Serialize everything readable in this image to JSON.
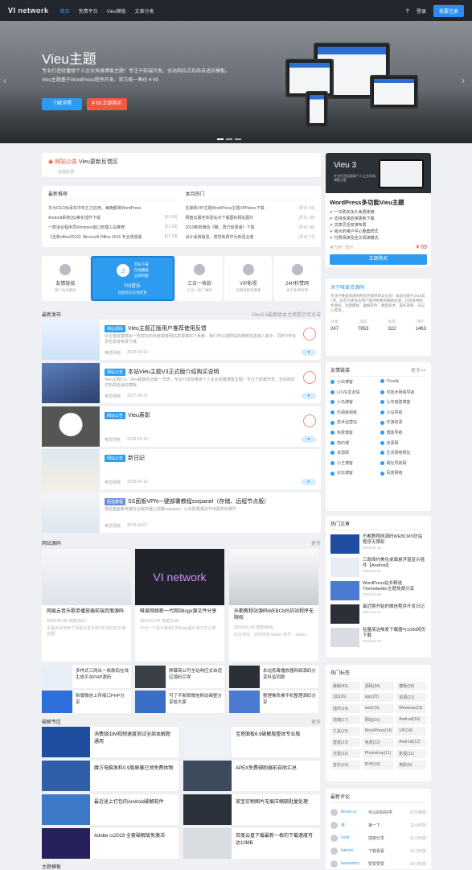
{
  "nav": {
    "logo": "VI",
    "logo2": "network",
    "items": [
      "首页",
      "免费平台",
      "Vieu模板",
      "文章分类"
    ],
    "login": "登录",
    "register": "我要注册"
  },
  "hero": {
    "title": "Vieu主题",
    "desc": "专业打造轻量级个人企业风格博客主题！专注于前端开发，全站响应式布局自适应模板。Vieu主题基于WordPress程序开发，官方统一售价 ¥ 69",
    "btn1": "了解详情",
    "btn2": "¥ 69 立即购买"
  },
  "notice": {
    "title": "网站公告",
    "text": "Vieu更新反馈区",
    "sub": "欢迎反馈"
  },
  "lists": {
    "left_title": "最新推荐",
    "right_title": "本月热门",
    "left": [
      [
        "华为CEO余承东中年乏力应用，每晚都将WordPress",
        ""
      ],
      [
        "Android系统QQ美化插件下载",
        "[01-06]"
      ],
      [
        "一款适合程序员Windows窗口管理工具推荐",
        "[01-08]"
      ],
      [
        "【全新office2016】Microsoft Office 2016 专业增强版",
        "[01-28]"
      ]
    ],
    "right": [
      [
        "在最新VIP主题WordPress主题VIPNews下载",
        "[评论 43]"
      ],
      [
        "网盘云服务体验站点下载图标网站图片",
        "[评论 39]"
      ],
      [
        "2019新款微信《聚，再已和更版》下载",
        "[评论 28]"
      ],
      [
        "设计适用最强，感觉免费作为新强业者",
        "[评论 17]"
      ]
    ]
  },
  "tiles": [
    {
      "name": "友情链接",
      "sub": "每个站点都有"
    },
    {
      "name": "FM音乐",
      "sub": "优质音乐在线欣赏",
      "items": [
        "音乐下载",
        "在线播放",
        "立即听取"
      ],
      "btn": "点击进入"
    },
    {
      "name": "三合一收款",
      "sub": "三合一的二维码"
    },
    {
      "name": "VIP影视",
      "sub": "全网视频免费看"
    },
    {
      "name": "24H秒赞网",
      "sub": "永久免费秒赞"
    }
  ],
  "latest": {
    "title": "最新发布",
    "note": "Vieu3.6最新版本主题提示可点击"
  },
  "posts": [
    {
      "tag": "网站源码",
      "title": "Vieu主题正版用户推荐使用反馈",
      "excerpt": "对主题运营做出一些突出的贡献或者网站发展做出了贡献，我们可以把网站的推荐信息放入其中，同时VIP会员也享有免费下载",
      "author": "唯爱网络",
      "date": "2019-04-13"
    },
    {
      "tag": "网站公告",
      "title": "本站Vieu主题V3正式版介绍购买说明",
      "excerpt": "Vieu主题3.0，Vieu模板的功能一览表，专业打造轻量级个人企业风格博客主题！专注于前端开发，全站响应式布局自适应模板",
      "author": "唯爱网络",
      "date": "2017-08-22"
    },
    {
      "tag": "网站公告",
      "title": "Vieu表彰",
      "excerpt": "",
      "author": "唯爱网络",
      "date": "2019-04-13"
    },
    {
      "tag": "网站公告",
      "title": "新日記",
      "excerpt": "",
      "author": "唯爱网络",
      "date": "2019-04-13"
    },
    {
      "tag": "经验教程",
      "title": "SS面板VPN一键部署教程ssrpanel（存储、远程节点版）",
      "excerpt": "把这套面板安装在云服务器上部署ssrpanel，以及配置相关节点服务的细节",
      "author": "唯爱网络",
      "date": "2019-04-07"
    }
  ],
  "source": {
    "title": "网站源码",
    "more": "更多",
    "big": [
      {
        "title": "网易云音乐歌单播放器前端页面源码",
        "date": "2019-03-30",
        "views": "浏览(561)",
        "excerpt": "本程序是使用了网易云音乐API实现的音乐播放器"
      },
      {
        "title": "唯爱网络新一代网站logo源文件分享",
        "date": "2019-01-07",
        "views": "浏览(119)",
        "excerpt": "作为一个设计者我们的logo图片源文件分享"
      },
      {
        "title": "乐都教程站源码WEBCMS仿站程序无限权",
        "date": "2019-01-10",
        "views": "浏览(494)",
        "excerpt": "后台地址：您的域名/admin 账号：admin"
      }
    ],
    "small": [
      "多样式三网合一收款码在线生成平台PHP源码",
      "屏幕商公可全站响应式自适应源码引导",
      "本站抵毒播放器网络源码分享抖音同款",
      "新版微信上传接口PHP分享",
      "可了不新款微信刷动画整分享给大家",
      "整理佛系佛手机整理源码分享"
    ]
  },
  "cracks": {
    "title": "破解专区",
    "more": "更多",
    "items": [
      {
        "title": "消费级IDM视频速度测试全部本解题通用",
        "excerpt": ""
      },
      {
        "title": "宝塔面板6.9破解版整体专业版",
        "excerpt": ""
      },
      {
        "title": "魔方电脑发料0.9版屏蔽已领免费体物",
        "excerpt": ""
      },
      {
        "title": "APEX免费辅助器前自助汇总",
        "excerpt": ""
      },
      {
        "title": "最近途上打包的Android破解软件",
        "excerpt": ""
      },
      {
        "title": "某宝实物图片无痕压缩颇批量处理",
        "excerpt": ""
      },
      {
        "title": "Adobe cc2019 全套破解版免激活",
        "excerpt": ""
      },
      {
        "title": "百度云盘下载最新一根的下载速度可达10MB",
        "excerpt": ""
      }
    ]
  },
  "theme_tpl": {
    "title": "主题模板"
  },
  "vieu3": {
    "logo": "Vieu 3",
    "desc": "专业打造轻量级个人企业风格博客主题",
    "name": "WordPress多功能Vieu主题",
    "features": [
      "一次购买永久免费使用",
      "支持多端应用更新下载",
      "文章灵活安排布局",
      "强大的用户中心整套样式",
      "付费阅读及全文阅读模式"
    ],
    "price_label": "官方统一售价",
    "price": "¥ 69",
    "buy": "立即购买"
  },
  "about": {
    "title": "关于唯爱资源网",
    "text": "专注于唯爱资源的所有开源项目与分享！本站创建于2018年7月，旨在为更多的用户提供免费的网络资源，包括各种软件源码、主题模板、破解软件、教程技术、操作系统、日记心得等。",
    "stats": [
      [
        "文章",
        "247"
      ],
      [
        "浏览",
        "7653"
      ],
      [
        "标签",
        "322"
      ],
      [
        "用户",
        "1463"
      ]
    ]
  },
  "links": {
    "title": "友情链接",
    "more": "更多>>",
    "items": [
      "小白博客",
      "iTrustly",
      "LOVE爱友情",
      "可技术网络导航",
      "小鸟博客",
      "七年度建博客",
      "乐阁者阁者",
      "小鸟导航",
      "技术运营站",
      "天游资源",
      "免费博客",
      "博客导航",
      "简约博",
      "资源网",
      "资源网",
      "生活网络网址",
      "小王博客",
      "网址导航网",
      "论坛博客",
      "百度网络"
    ]
  },
  "hot": {
    "title": "热门文章",
    "items": [
      {
        "title": "乐都教程网源码WEBCMS仿站程序无限权",
        "date": "2019-01-10"
      },
      {
        "title": "三款简约美化桌面悬浮窗显示插件【Android】",
        "date": "2019-01-27"
      },
      {
        "title": "WordPress站长精选Themebetter主题免费分享",
        "date": "2018-10-20"
      },
      {
        "title": "最近刚开始的微信程序开发日记",
        "date": "2017-12-11"
      },
      {
        "title": "轻量简洁唯爱下载器与1000网页下载",
        "date": "2019-02-17"
      }
    ]
  },
  "tags": {
    "title": "热门标签",
    "items": [
      "破解(40)",
      "源码(34)",
      "模板(30)",
      "QQ(26)",
      "app(20)",
      "资源(21)",
      "插件(19)",
      "web(19)",
      "Windows(19)",
      "前端(17)",
      "网站(16)",
      "Android(16)",
      "工具(15)",
      "WordPress(14)",
      "VIP(14)",
      "壁纸(13)",
      "免费(12)",
      "Android(12)",
      "付费(12)",
      "Photoshop(11)",
      "影视(11)",
      "音乐(10)",
      "PHP(10)",
      "电影(9)"
    ]
  },
  "comments": {
    "title": "最新评论",
    "items": [
      {
        "name": "Brook.cy",
        "text": "可以的好好学",
        "date": "12分钟前"
      },
      {
        "name": "林",
        "text": "第一下",
        "date": "11小时前"
      },
      {
        "name": "Gold",
        "text": "感谢分享",
        "date": "11小时前"
      },
      {
        "name": "kamoti",
        "text": "下载看看",
        "date": "11小时前"
      },
      {
        "name": "lassisstory",
        "text": "赞赞赞赞",
        "date": "14小时前"
      }
    ]
  },
  "colors": {
    "accent": "#2d9cf0",
    "danger": "#e6482d",
    "nav": "#23262d"
  }
}
